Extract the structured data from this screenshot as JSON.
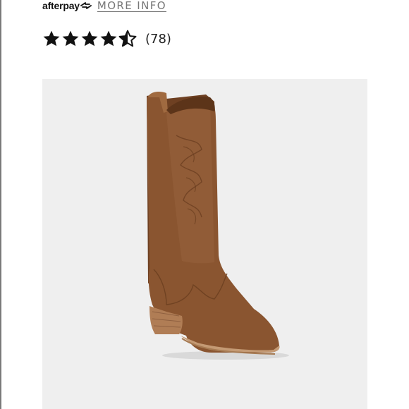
{
  "afterpay": {
    "logo_text": "afterpay",
    "logo_icon": "afterpay-arrows-icon",
    "more_info_label": "MORE INFO"
  },
  "rating": {
    "value": 4.5,
    "max": 5,
    "count_label": "(78)"
  },
  "product_image": {
    "alt": "Tall brown suede western boot",
    "background_color": "#efefef",
    "boot_color": "#8a5530"
  },
  "colors": {
    "star": "#111111",
    "more_info": "#777777"
  }
}
